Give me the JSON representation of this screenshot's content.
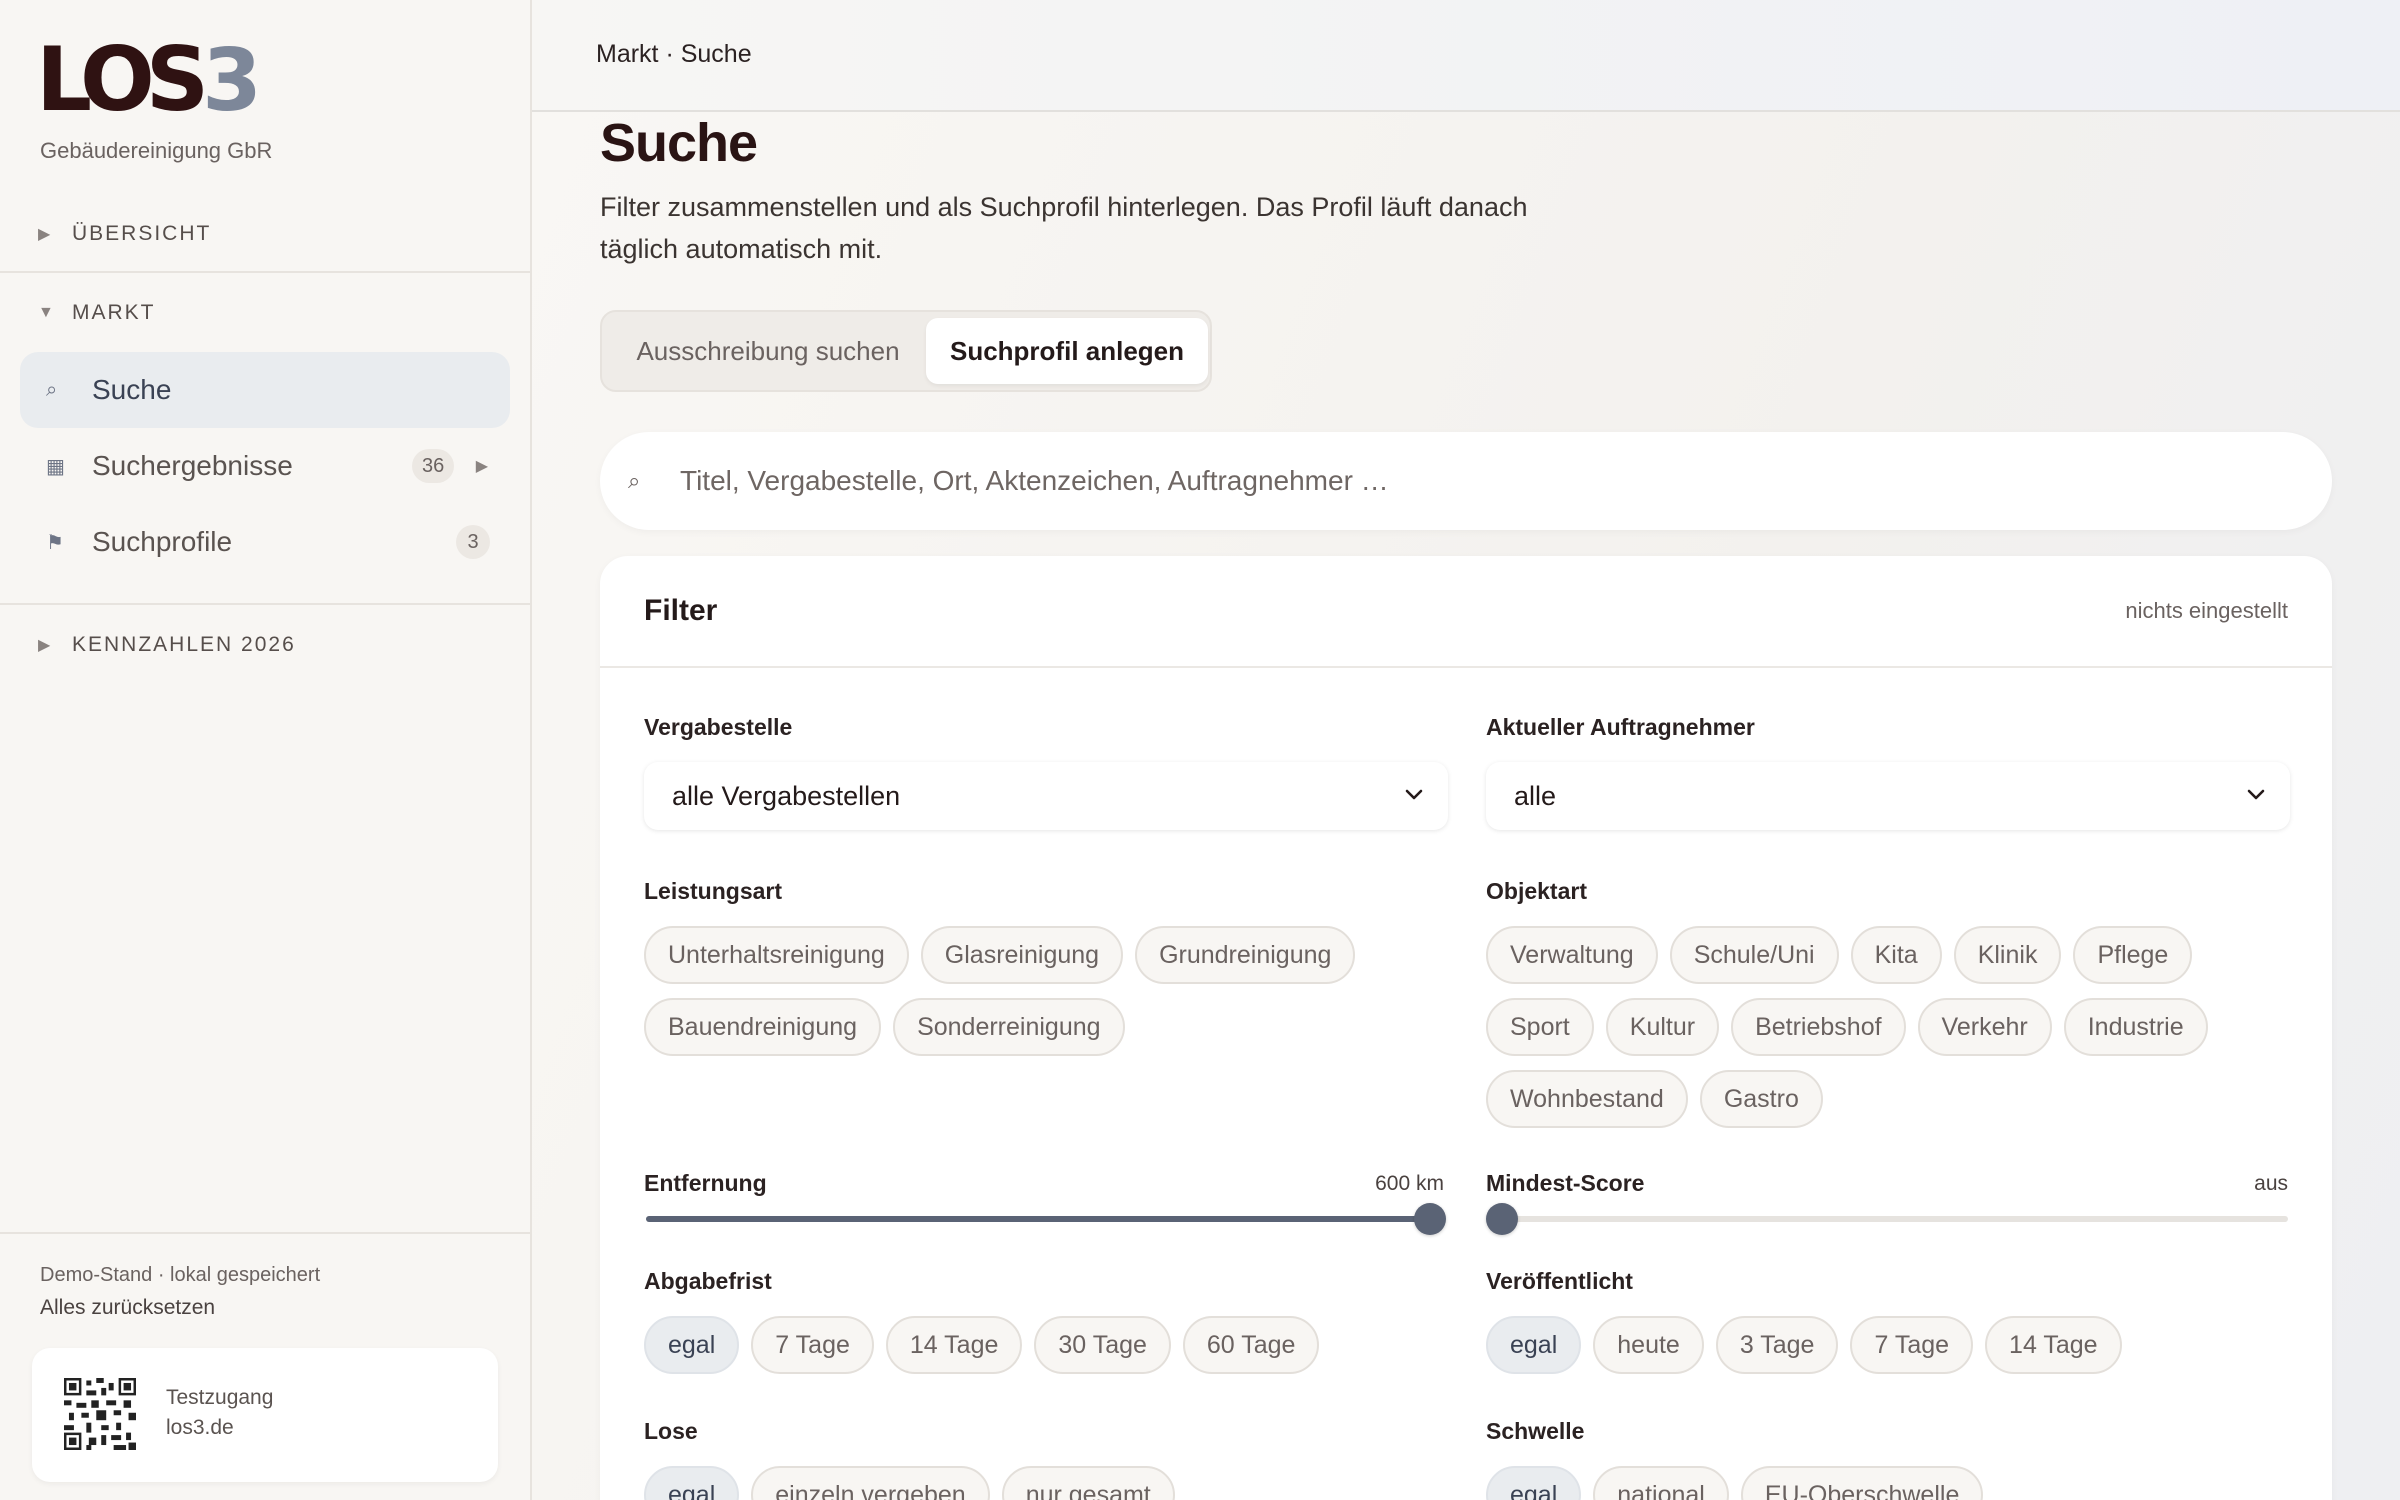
{
  "brand": {
    "logo_main": "LOS",
    "logo_num": "3",
    "company": "Gebäudereinigung GbR"
  },
  "sidebar": {
    "sections": [
      {
        "label": "ÜBERSICHT",
        "expanded": false
      },
      {
        "label": "MARKT",
        "expanded": true
      },
      {
        "label": "KENNZAHLEN 2026",
        "expanded": false
      }
    ],
    "items": [
      {
        "label": "Suche",
        "icon": "search-icon",
        "active": true
      },
      {
        "label": "Suchergebnisse",
        "icon": "grid-icon",
        "badge": "36"
      },
      {
        "label": "Suchprofile",
        "icon": "flag-icon",
        "badge": "3"
      }
    ],
    "footer": {
      "status": "Demo-Stand · lokal gespeichert",
      "reset": "Alles zurücksetzen",
      "qr_line1": "Testzugang",
      "qr_line2": "los3.de"
    }
  },
  "header": {
    "breadcrumb": "Markt · Suche"
  },
  "page": {
    "title": "Suche",
    "description": "Filter zusammenstellen und als Suchprofil hinterlegen. Das Profil läuft danach täglich automatisch mit.",
    "tabs": [
      {
        "label": "Ausschreibung suchen",
        "active": false
      },
      {
        "label": "Suchprofil anlegen",
        "active": true
      }
    ],
    "search_placeholder": "Titel, Vergabestelle, Ort, Aktenzeichen, Auftragnehmer …"
  },
  "filter": {
    "title": "Filter",
    "status": "nichts eingestellt",
    "vergabestelle": {
      "label": "Vergabestelle",
      "value": "alle Vergabestellen"
    },
    "auftragnehmer": {
      "label": "Aktueller Auftragnehmer",
      "value": "alle"
    },
    "leistungsart": {
      "label": "Leistungsart",
      "options": [
        "Unterhaltsreinigung",
        "Glasreinigung",
        "Grundreinigung",
        "Bauendreinigung",
        "Sonderreinigung"
      ]
    },
    "objektart": {
      "label": "Objektart",
      "options": [
        "Verwaltung",
        "Schule/Uni",
        "Kita",
        "Klinik",
        "Pflege",
        "Sport",
        "Kultur",
        "Betriebshof",
        "Verkehr",
        "Industrie",
        "Wohnbestand",
        "Gastro"
      ]
    },
    "entfernung": {
      "label": "Entfernung",
      "value_text": "600 km",
      "fraction": 1.0
    },
    "mindest_score": {
      "label": "Mindest-Score",
      "value_text": "aus",
      "fraction": 0.0
    },
    "abgabefrist": {
      "label": "Abgabefrist",
      "options": [
        "egal",
        "7 Tage",
        "14 Tage",
        "30 Tage",
        "60 Tage"
      ],
      "selected": "egal"
    },
    "veroeffentlicht": {
      "label": "Veröffentlicht",
      "options": [
        "egal",
        "heute",
        "3 Tage",
        "7 Tage",
        "14 Tage"
      ],
      "selected": "egal"
    },
    "lose": {
      "label": "Lose",
      "options": [
        "egal",
        "einzeln vergeben",
        "nur gesamt"
      ],
      "selected": "egal"
    },
    "schwelle": {
      "label": "Schwelle",
      "options": [
        "egal",
        "national",
        "EU-Oberschwelle"
      ],
      "selected": "egal"
    }
  },
  "colors": {
    "accent": "#5a6375",
    "brand_dark": "#2f1212",
    "brand_gray": "#7d8799"
  }
}
